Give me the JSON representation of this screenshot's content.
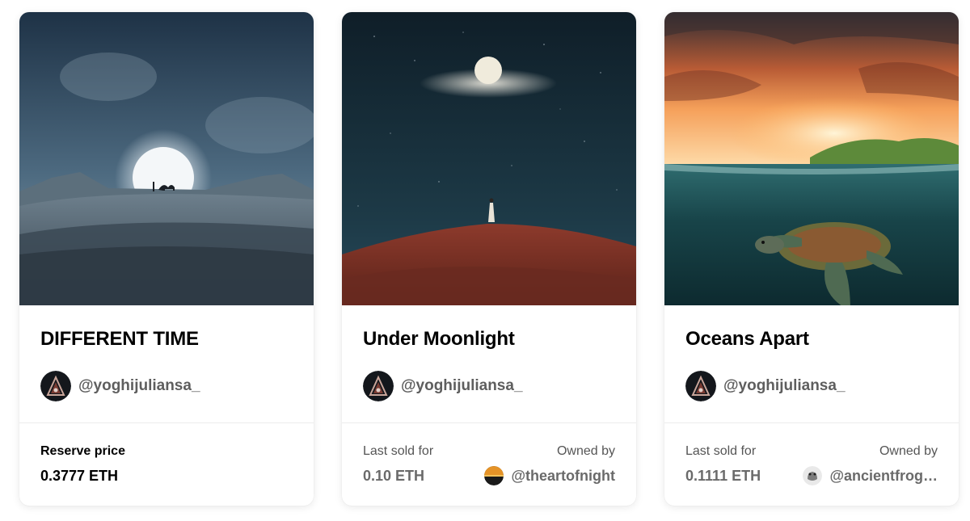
{
  "cards": [
    {
      "title": "DIFFERENT TIME",
      "creator": "@yoghijuliansa_",
      "footer_label": "Reserve price",
      "price": "0.3777 ETH",
      "artwork_icon": "desert-moon-artwork"
    },
    {
      "title": "Under Moonlight",
      "creator": "@yoghijuliansa_",
      "footer_label": "Last sold for",
      "price": "0.10 ETH",
      "owner_label": "Owned by",
      "owner": "@theartofnight",
      "artwork_icon": "red-hill-moon-artwork"
    },
    {
      "title": "Oceans Apart",
      "creator": "@yoghijuliansa_",
      "footer_label": "Last sold for",
      "price": "0.1111 ETH",
      "owner_label": "Owned by",
      "owner": "@ancientfrog…",
      "artwork_icon": "sea-turtle-artwork"
    }
  ],
  "colors": {
    "title": "#000000",
    "handle": "#5e5e5e",
    "muted": "#555555",
    "card_bg": "#ffffff"
  }
}
